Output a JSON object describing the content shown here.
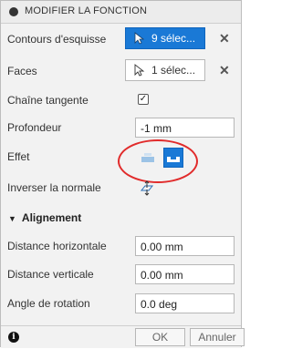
{
  "dialog": {
    "title": "MODIFIER LA FONCTION"
  },
  "fields": {
    "contours_label": "Contours d'esquisse",
    "contours_value": "9 sélec...",
    "faces_label": "Faces",
    "faces_value": "1 sélec...",
    "chaine_label": "Chaîne tangente",
    "chaine_checked": "✓",
    "profondeur_label": "Profondeur",
    "profondeur_value": "-1 mm",
    "effet_label": "Effet",
    "inverser_label": "Inverser la normale"
  },
  "alignement": {
    "title": "Alignement",
    "dist_h_label": "Distance horizontale",
    "dist_h_value": "0.00 mm",
    "dist_v_label": "Distance verticale",
    "dist_v_value": "0.00 mm",
    "angle_label": "Angle de rotation",
    "angle_value": "0.0 deg"
  },
  "footer": {
    "ok_label": "OK",
    "cancel_label": "Annuler"
  },
  "colors": {
    "accent": "#1a79d6",
    "highlight_ring": "#e12b2b"
  }
}
